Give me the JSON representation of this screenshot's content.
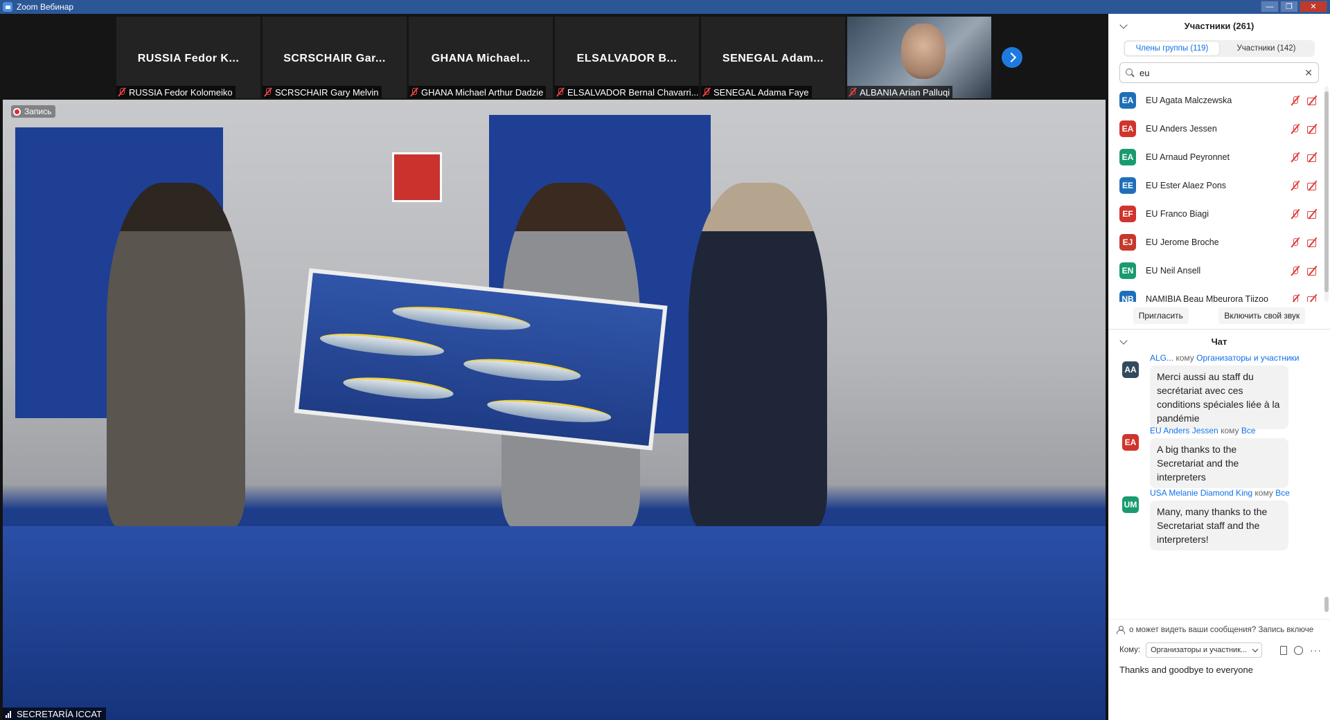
{
  "window": {
    "title": "Zoom Вебинар"
  },
  "strip": {
    "tiles": [
      {
        "big": "RUSSIA Fedor K...",
        "small": "RUSSIA Fedor Kolomeiko"
      },
      {
        "big": "SCRSCHAIR Gar...",
        "small": "SCRSCHAIR Gary Melvin"
      },
      {
        "big": "GHANA Michael...",
        "small": "GHANA Michael Arthur Dadzie"
      },
      {
        "big": "ELSALVADOR B...",
        "small": "ELSALVADOR Bernal Chavarri..."
      },
      {
        "big": "SENEGAL Adam...",
        "small": "SENEGAL Adama Faye"
      },
      {
        "big": "",
        "small": "ALBANIA Arian Palluqi"
      }
    ]
  },
  "main": {
    "recording_label": "Запись",
    "speaker_label": "SECRETARÍA ICCAT"
  },
  "participants": {
    "title": "Участники (261)",
    "tabs": [
      "Члены группы (119)",
      "Участники (142)"
    ],
    "search_value": "eu",
    "list": [
      {
        "initials": "EA",
        "name": "EU Agata Malczewska",
        "color": "#1f6fb8"
      },
      {
        "initials": "EA",
        "name": "EU Anders Jessen",
        "color": "#d0342c"
      },
      {
        "initials": "EA",
        "name": "EU Arnaud Peyronnet",
        "color": "#1a9b6f"
      },
      {
        "initials": "EE",
        "name": "EU Ester Alaez Pons",
        "color": "#1f6fb8"
      },
      {
        "initials": "EF",
        "name": "EU Franco Biagi",
        "color": "#d0342c"
      },
      {
        "initials": "EJ",
        "name": "EU Jerome Broche",
        "color": "#c8392b"
      },
      {
        "initials": "EN",
        "name": "EU Neil Ansell",
        "color": "#1a9b6f"
      },
      {
        "initials": "NB",
        "name": "NAMIBIA Beau Mbeurora Tjizoo",
        "color": "#1f6fb8"
      }
    ],
    "invite": "Пригласить",
    "unmute": "Включить свой звук"
  },
  "chat": {
    "title": "Чат",
    "messages": [
      {
        "initials": "AA",
        "color": "#34495e",
        "sender": "ALG...",
        "to_word": "кому",
        "recipient": "Организаторы и участники",
        "text": "Merci aussi au staff du secrétariat avec ces conditions spéciales liée à la pandémie"
      },
      {
        "initials": "EA",
        "color": "#d0342c",
        "sender": "EU Anders Jessen",
        "to_word": "кому",
        "recipient": "Все",
        "text": "A big thanks to the Secretariat and the interpreters"
      },
      {
        "initials": "UM",
        "color": "#1a9b6f",
        "sender": "USA Melanie Diamond King",
        "to_word": "кому",
        "recipient": "Все",
        "text": "Many, many thanks to the Secretariat staff and the interpreters!"
      }
    ],
    "privacy": "о может видеть ваши сообщения? Запись включе",
    "to_label": "Кому:",
    "to_value": "Организаторы и участник...",
    "input_text": "Thanks and goodbye to everyone"
  }
}
